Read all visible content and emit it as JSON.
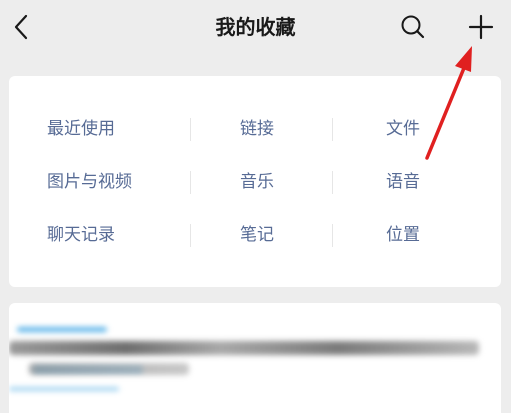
{
  "header": {
    "title": "我的收藏",
    "back_icon": "chevron-left-icon",
    "search_icon": "search-icon",
    "add_icon": "plus-icon"
  },
  "categories": {
    "rows": [
      [
        "最近使用",
        "链接",
        "文件"
      ],
      [
        "图片与视频",
        "音乐",
        "语音"
      ],
      [
        "聊天记录",
        "笔记",
        "位置"
      ]
    ]
  },
  "colors": {
    "background": "#ededed",
    "card": "#ffffff",
    "category_text": "#576b95",
    "title_text": "#191919",
    "annotation_arrow": "#e02020"
  }
}
